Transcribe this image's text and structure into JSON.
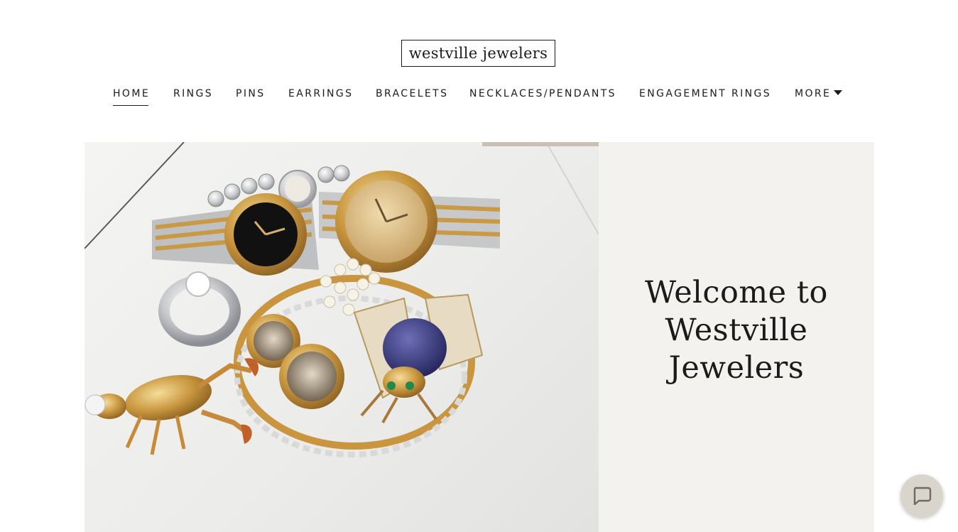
{
  "header": {
    "logo_text": "westville jewelers"
  },
  "nav": {
    "items": [
      {
        "label": "HOME",
        "active": true
      },
      {
        "label": "RINGS",
        "active": false
      },
      {
        "label": "PINS",
        "active": false
      },
      {
        "label": "EARRINGS",
        "active": false
      },
      {
        "label": "BRACELETS",
        "active": false
      },
      {
        "label": "NECKLACES/PENDANTS",
        "active": false
      },
      {
        "label": "ENGAGEMENT RINGS",
        "active": false
      },
      {
        "label": "MORE",
        "active": false,
        "has_dropdown": true
      }
    ]
  },
  "hero": {
    "title": "Welcome to Westville Jewelers",
    "image_alt": "jewelry-collection-photo"
  },
  "chat": {
    "icon": "chat-bubble-icon"
  },
  "colors": {
    "text": "#1b1b1b",
    "panel_background": "#f3f2ef",
    "chat_button": "#d9d4cc"
  }
}
